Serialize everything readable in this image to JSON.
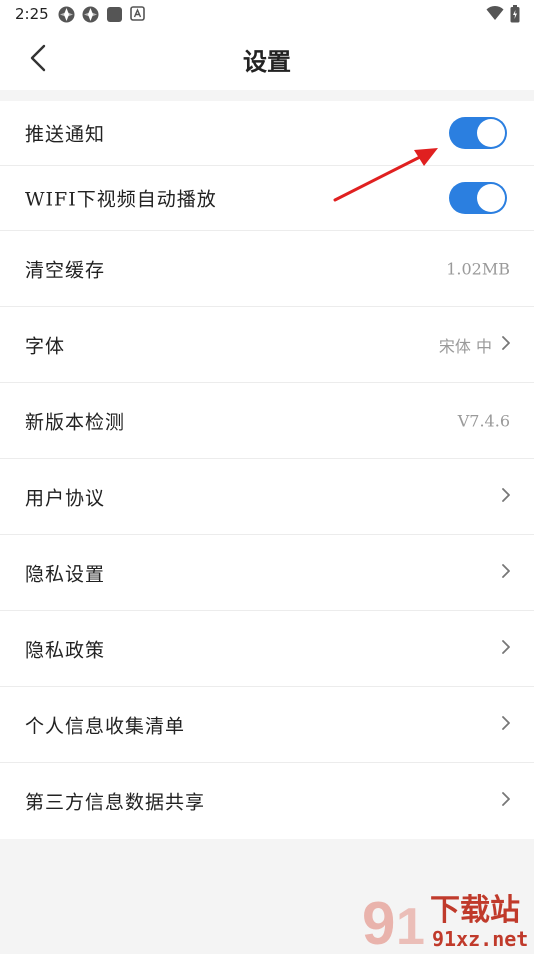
{
  "status_bar": {
    "time": "2:25",
    "left_icons": [
      "app-icon",
      "app-icon",
      "square-icon",
      "a-letter-icon"
    ],
    "right_icons": [
      "wifi-icon",
      "battery-icon"
    ]
  },
  "header": {
    "title": "设置",
    "back_icon": "chevron-left-icon"
  },
  "settings": {
    "items": [
      {
        "label": "推送通知",
        "control": "toggle",
        "on": true
      },
      {
        "label": "WIFI下视频自动播放",
        "control": "toggle",
        "on": true
      },
      {
        "label": "清空缓存",
        "value": "1.02MB"
      },
      {
        "label": "字体",
        "value": "宋体 中",
        "chevron": true
      },
      {
        "label": "新版本检测",
        "value": "V7.4.6"
      },
      {
        "label": "用户协议",
        "chevron": true
      },
      {
        "label": "隐私设置",
        "chevron": true
      },
      {
        "label": "隐私政策",
        "chevron": true
      },
      {
        "label": "个人信息收集清单",
        "chevron": true
      },
      {
        "label": "第三方信息数据共享",
        "chevron": true
      }
    ]
  },
  "colors": {
    "toggle_on": "#2b7fe0",
    "annotation_arrow": "#e02020",
    "page_background": "#f4f4f4"
  },
  "watermark": {
    "text_cn": "下载站",
    "text_url": "91xz.net"
  }
}
